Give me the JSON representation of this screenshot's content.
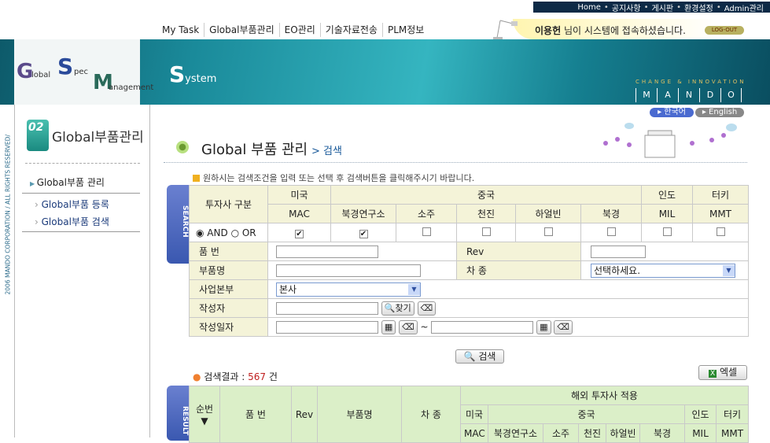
{
  "top_links": [
    "Home",
    "공지사항",
    "게시판",
    "환경설정",
    "Admin관리"
  ],
  "menu": [
    "My Task",
    "Global부품관리",
    "EO관리",
    "기술자료전송",
    "PLM정보"
  ],
  "welcome": {
    "user": "이용헌",
    "text": " 님이 시스템에 접속하셨습니다.",
    "logout": "LOG-OUT"
  },
  "logo": {
    "g": "G",
    "global": "lobal",
    "s": "S",
    "spec": "pec",
    "m": "M",
    "management": "anagement",
    "s2": "S",
    "system": "ystem"
  },
  "banner": {
    "slogan": "CHANGE & INNOVATION",
    "letters": [
      "M",
      "A",
      "N",
      "D",
      "O"
    ]
  },
  "lang": {
    "ko": "▸ 한국어",
    "en": "▸ English"
  },
  "copyright": "2006 MANDO CORPORATION / ALL RIGHTS RESERVED/",
  "sidebar": {
    "icon": "02",
    "title": "Global부품관리",
    "main": "Global부품 관리",
    "items": [
      "Global부품 등록",
      "Global부품 검색"
    ]
  },
  "page": {
    "title": "Global 부품 관리",
    "sub": "> 검색",
    "notice": "원하시는 검색조건을 입력 또는 선택 후 검색버튼을 클릭해주시기 바랍니다."
  },
  "search": {
    "tab": "SEARCH",
    "investor_label": "투자사 구분",
    "countries": {
      "us": "미국",
      "cn": "중국",
      "in": "인도",
      "tr": "터키"
    },
    "sites": [
      {
        "name": "MAC",
        "checked": true
      },
      {
        "name": "북경연구소",
        "checked": true
      },
      {
        "name": "소주",
        "checked": false
      },
      {
        "name": "천진",
        "checked": false
      },
      {
        "name": "하얼빈",
        "checked": false
      },
      {
        "name": "북경",
        "checked": false
      },
      {
        "name": "MIL",
        "checked": false
      },
      {
        "name": "MMT",
        "checked": false
      }
    ],
    "and": "AND",
    "or": "OR",
    "mode": "AND",
    "part_no": "품 번",
    "rev": "Rev",
    "part_name": "부품명",
    "car_type": "차 종",
    "car_type_value": "선택하세요.",
    "division": "사업본부",
    "division_value": "본사",
    "author": "작성자",
    "find": "찾기",
    "date": "작성일자",
    "tilde": "~",
    "button": "검색"
  },
  "result": {
    "tab": "RESULT",
    "label": "검색결과 : ",
    "count": "567",
    "unit": " 건",
    "excel": "엑셀",
    "cols": {
      "no": "순번▼",
      "part_no": "품 번",
      "rev": "Rev",
      "part_name": "부품명",
      "car": "차 종",
      "overseas": "해외 투자사 적용",
      "us": "미국",
      "cn": "중국",
      "in": "인도",
      "tr": "터키"
    },
    "sites": [
      "MAC",
      "북경연구소",
      "소주",
      "천진",
      "하얼빈",
      "북경",
      "MIL",
      "MMT"
    ]
  }
}
